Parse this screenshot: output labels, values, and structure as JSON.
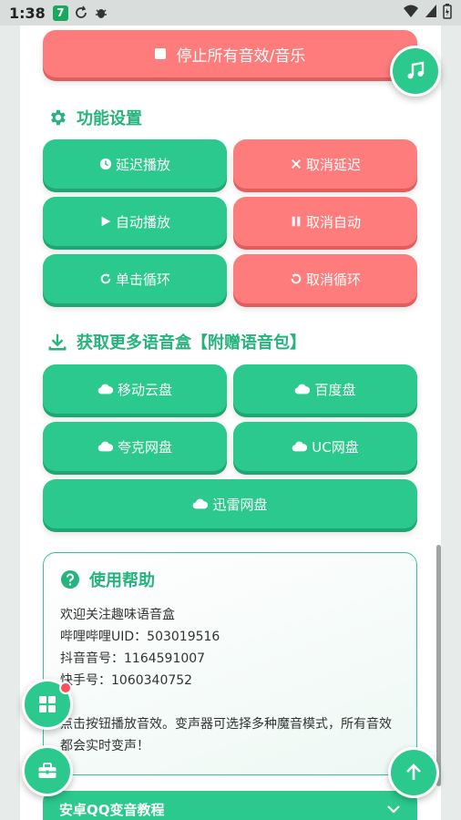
{
  "status_bar": {
    "time": "1:38",
    "badge": "7"
  },
  "stop_button": {
    "label": "停止所有音效/音乐"
  },
  "settings": {
    "title": "功能设置",
    "buttons": [
      {
        "label": "延迟播放"
      },
      {
        "label": "取消延迟"
      },
      {
        "label": "自动播放"
      },
      {
        "label": "取消自动"
      },
      {
        "label": "单击循环"
      },
      {
        "label": "取消循环"
      }
    ]
  },
  "download": {
    "title": "获取更多语音盒【附赠语音包】",
    "buttons": [
      {
        "label": "移动云盘"
      },
      {
        "label": "百度盘"
      },
      {
        "label": "夸克网盘"
      },
      {
        "label": "UC网盘"
      },
      {
        "label": "迅雷网盘"
      }
    ]
  },
  "help": {
    "title": "使用帮助",
    "lines": [
      "欢迎关注趣味语音盒",
      "哔哩哔哩UID：503019516",
      "抖音音号：1164591007",
      "快手号：1060340752",
      "",
      "点击按钮播放音效。变声器可选择多种魔音模式，所有音效都会实时变声！"
    ]
  },
  "bottom_bar": {
    "label": "安卓QQ变音教程"
  },
  "colors": {
    "green": "#2bc98d",
    "red": "#ff7c7c",
    "title_green": "#26b37d"
  }
}
